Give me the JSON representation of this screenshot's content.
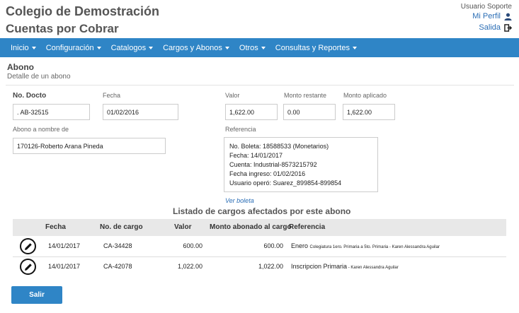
{
  "header": {
    "title": "Colegio de Demostración",
    "subtitle": "Cuentas por Cobrar",
    "user_name": "Usuario Soporte",
    "profile_link": "Mi Perfil",
    "logout_link": "Salida"
  },
  "nav": {
    "items": [
      {
        "label": "Inicio"
      },
      {
        "label": "Configuración"
      },
      {
        "label": "Catalogos"
      },
      {
        "label": "Cargos y Abonos"
      },
      {
        "label": "Otros"
      },
      {
        "label": "Consultas y Reportes"
      }
    ],
    "color": "#2f85c6"
  },
  "section": {
    "title": "Abono",
    "subtitle": "Detalle de un abono"
  },
  "form": {
    "no_docto_label": "No. Docto",
    "no_docto_value": ". AB-32515",
    "fecha_label": "Fecha",
    "fecha_value": "01/02/2016",
    "valor_label": "Valor",
    "valor_value": "1,622.00",
    "monto_restante_label": "Monto restante",
    "monto_restante_value": "0.00",
    "monto_aplicado_label": "Monto aplicado",
    "monto_aplicado_value": "1,622.00",
    "abono_nombre_label": "Abono a nombre de",
    "abono_nombre_value": "170126-Roberto Arana Pineda",
    "referencia_label": "Referencia",
    "referencia_lines": [
      "No. Boleta: 18588533 (Monetarios)",
      "Fecha: 14/01/2017",
      "Cuenta: Industrial-8573215792",
      "Fecha ingreso:  01/02/2016",
      "Usuario operó: Suarez_899854-899854"
    ],
    "ver_boleta": "Ver boleta"
  },
  "list": {
    "title": "Listado de cargos afectados por este abono",
    "headers": {
      "fecha": "Fecha",
      "no_cargo": "No. de cargo",
      "valor": "Valor",
      "monto_abonado": "Monto abonado al cargo",
      "referencia": "Referencia"
    },
    "rows": [
      {
        "fecha": "14/01/2017",
        "no_cargo": "CA-34428",
        "valor": "600.00",
        "monto_abonado": "600.00",
        "ref_main": "Enero",
        "ref_detail": "Colegiatura 1ero. Primaria a 5to. Primaria - Karen Alessandra Aguilar"
      },
      {
        "fecha": "14/01/2017",
        "no_cargo": "CA-42078",
        "valor": "1,022.00",
        "monto_abonado": "1,022.00",
        "ref_main": "Inscripcion Primaria",
        "ref_detail": " - Karen Alessandra Aguilar"
      }
    ]
  },
  "footer": {
    "salir_label": "Salir"
  }
}
